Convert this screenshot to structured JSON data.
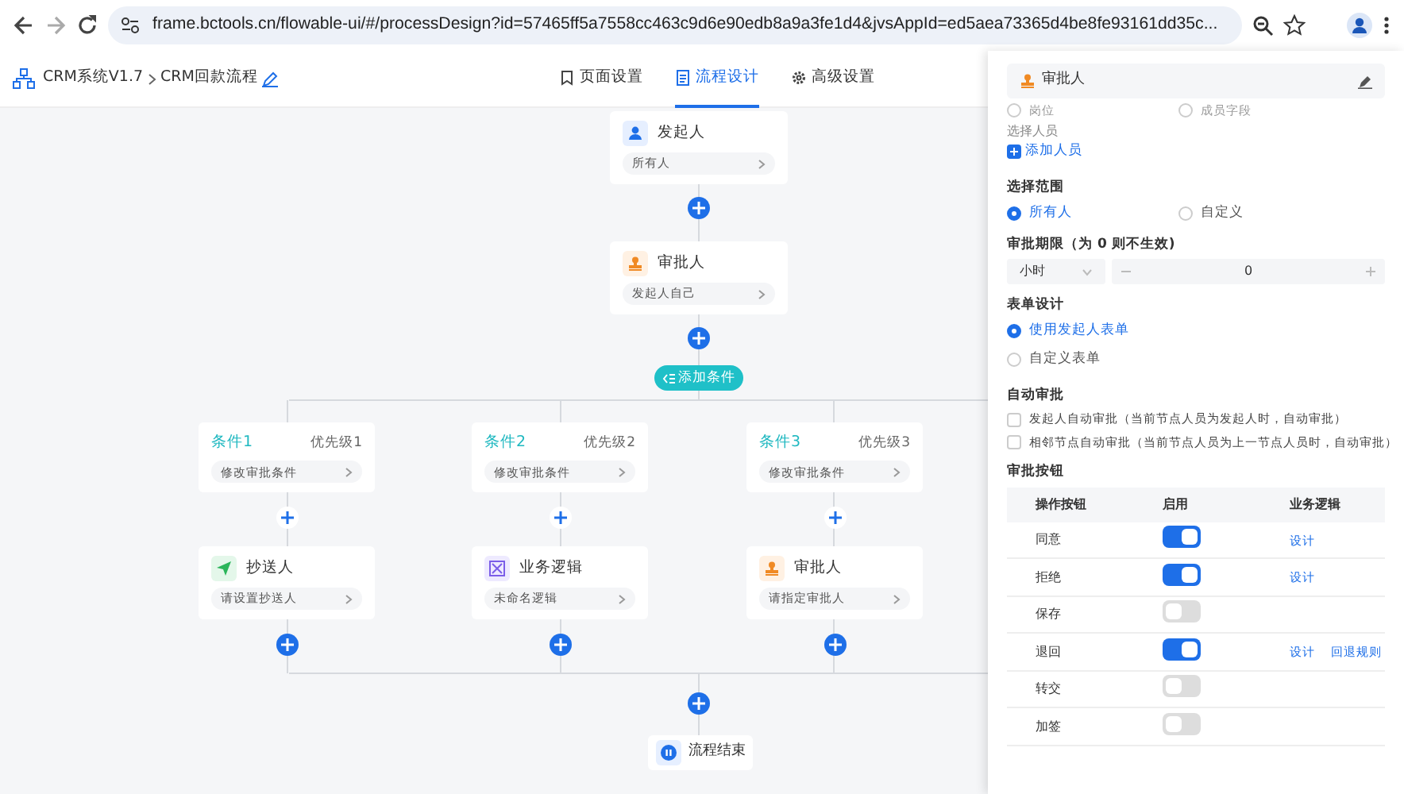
{
  "browser": {
    "url": "frame.bctools.cn/flowable-ui/#/processDesign?id=57465ff5a7558cc463c9d6e90edb8a9a3fe1d4&jvsAppId=ed5aea73365d4be8fe93161dd35c..."
  },
  "header": {
    "breadcrumb": [
      "CRM系统V1.7",
      "CRM回款流程"
    ],
    "tabs": [
      {
        "label": "页面设置",
        "selected": false
      },
      {
        "label": "流程设计",
        "selected": true
      },
      {
        "label": "高级设置",
        "selected": false
      }
    ]
  },
  "flow": {
    "nodes": [
      {
        "kind": "initiator",
        "title": "发起人",
        "value": "所有人"
      },
      {
        "kind": "approver",
        "title": "审批人",
        "value": "发起人自己"
      }
    ],
    "add_condition_button": "添加条件",
    "branches": [
      {
        "condition": "条件1",
        "priority": "优先级1",
        "condition_value": "修改审批条件",
        "node": {
          "kind": "copy",
          "title": "抄送人",
          "value": "请设置抄送人"
        }
      },
      {
        "condition": "条件2",
        "priority": "优先级2",
        "condition_value": "修改审批条件",
        "node": {
          "kind": "logic",
          "title": "业务逻辑",
          "value": "未命名逻辑"
        }
      },
      {
        "condition": "条件3",
        "priority": "优先级3",
        "condition_value": "修改审批条件",
        "node": {
          "kind": "approver",
          "title": "审批人",
          "value": "请指定审批人"
        }
      }
    ],
    "end_node": "流程结束"
  },
  "panel": {
    "title": "审批人",
    "approver_type_options": [
      {
        "label": "岗位",
        "selected": false
      },
      {
        "label": "成员字段",
        "selected": false
      }
    ],
    "select_people": {
      "label": "选择人员",
      "add_link": "添加人员"
    },
    "scope": {
      "label": "选择范围",
      "options": [
        {
          "label": "所有人",
          "selected": true
        },
        {
          "label": "自定义",
          "selected": false
        }
      ]
    },
    "period": {
      "label": "审批期限（为 0 则不生效)",
      "unit": "小时",
      "value": "0"
    },
    "form_design": {
      "label": "表单设计",
      "options": [
        {
          "label": "使用发起人表单",
          "selected": true
        },
        {
          "label": "自定义表单",
          "selected": false
        }
      ]
    },
    "auto_approve": {
      "label": "自动审批",
      "options": [
        {
          "label": "发起人自动审批（当前节点人员为发起人时，自动审批）",
          "checked": false
        },
        {
          "label": "相邻节点自动审批（当前节点人员为上一节点人员时，自动审批）",
          "checked": false
        }
      ]
    },
    "buttons_table": {
      "label": "审批按钮",
      "columns": [
        "操作按钮",
        "启用",
        "业务逻辑"
      ],
      "rows": [
        {
          "name": "同意",
          "on": true,
          "links": [
            "设计"
          ]
        },
        {
          "name": "拒绝",
          "on": true,
          "links": [
            "设计"
          ]
        },
        {
          "name": "保存",
          "on": false,
          "links": []
        },
        {
          "name": "退回",
          "on": true,
          "links": [
            "设计",
            "回退规则"
          ]
        },
        {
          "name": "转交",
          "on": false,
          "links": []
        },
        {
          "name": "加签",
          "on": false,
          "links": []
        }
      ]
    }
  }
}
